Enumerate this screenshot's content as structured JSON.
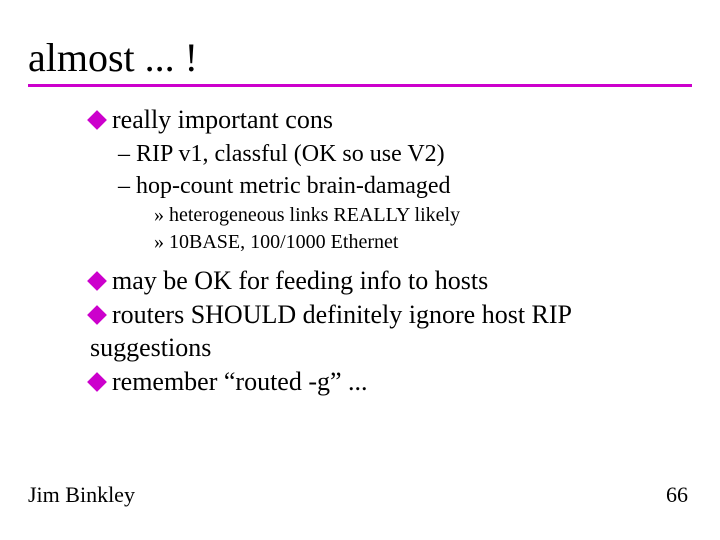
{
  "title": "almost ... !",
  "bullets": {
    "b1": {
      "text": "really important cons",
      "sub": {
        "s1": "– RIP v1, classful (OK so use V2)",
        "s2": "– hop-count metric brain-damaged",
        "sub2": {
          "t1": "» heterogeneous links REALLY likely",
          "t2": "» 10BASE, 100/1000 Ethernet"
        }
      }
    },
    "b2": {
      "text": "may be OK for feeding info to hosts"
    },
    "b3": {
      "text": "routers SHOULD definitely ignore host RIP suggestions"
    },
    "b4": {
      "text": "remember “routed -g” ..."
    }
  },
  "footer": {
    "author": "Jim Binkley",
    "page": "66"
  }
}
